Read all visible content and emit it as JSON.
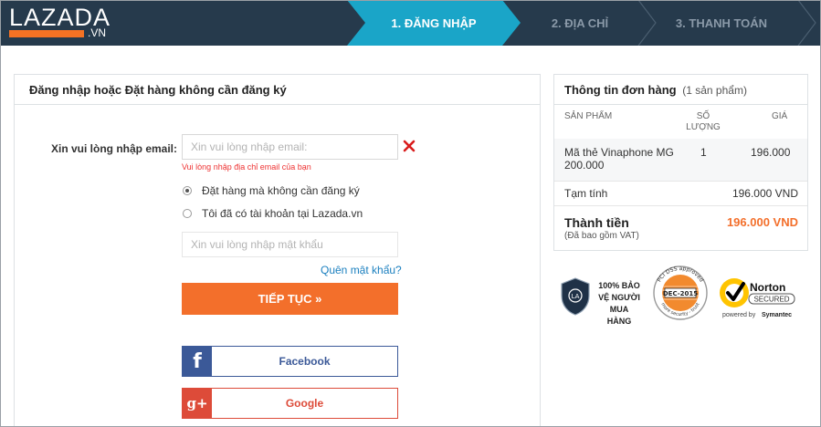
{
  "header": {
    "logo_text": "LAZADA",
    "logo_sub": ".VN",
    "steps": [
      {
        "label": "1. ĐĂNG NHẬP",
        "active": true
      },
      {
        "label": "2. ĐỊA CHỈ",
        "active": false
      },
      {
        "label": "3. THANH TOÁN",
        "active": false
      }
    ]
  },
  "login": {
    "title": "Đăng nhập hoặc Đặt hàng không cần đăng ký",
    "email_label": "Xin vui lòng nhập email:",
    "email_value": "",
    "email_placeholder": "Xin vui lòng nhập email:",
    "email_error": "Vui lòng nhập địa chỉ email của bạn",
    "options": [
      {
        "label": "Đặt hàng mà không cần đăng ký",
        "checked": true
      },
      {
        "label": "Tôi đã có tài khoản tại Lazada.vn",
        "checked": false
      }
    ],
    "password_placeholder": "Xin vui lòng nhập mật khẩu",
    "forgot_label": "Quên mật khẩu?",
    "continue_label": "TIẾP TỤC »",
    "facebook_label": "Facebook",
    "facebook_icon": "f",
    "google_label": "Google",
    "google_icon": "g+"
  },
  "order": {
    "title": "Thông tin đơn hàng",
    "count": "(1 sản phẩm)",
    "col_product": "SẢN PHẨM",
    "col_qty_1": "SỐ",
    "col_qty_2": "LƯỢNG",
    "col_price": "GIÁ",
    "item_name": "Mã thẻ Vinaphone MG 200.000",
    "item_qty": "1",
    "item_price": "196.000",
    "subtotal_label": "Tạm tính",
    "subtotal_value": "196.000 VND",
    "total_label": "Thành tiền",
    "total_value": "196.000 VND",
    "vat_note": "(Đã bao gồm VAT)"
  },
  "badges": {
    "protect_lines": [
      "100% BẢO",
      "VỆ NGƯỜI",
      "MUA",
      "HÀNG"
    ],
    "pci_top": "PCI DSS approved",
    "pci_date": "DEC-2015",
    "pci_bottom": "more security - trust",
    "norton_name": "Norton",
    "norton_secured": "SECURED",
    "norton_powered": "powered by",
    "norton_brand": "Symantec"
  },
  "colors": {
    "header_bg": "#263a4c",
    "step_active": "#1aa5c8",
    "accent_orange": "#f36f2b",
    "facebook": "#3b5998",
    "google": "#dd4b39",
    "link": "#1a7fbf",
    "error": "#e33333"
  }
}
